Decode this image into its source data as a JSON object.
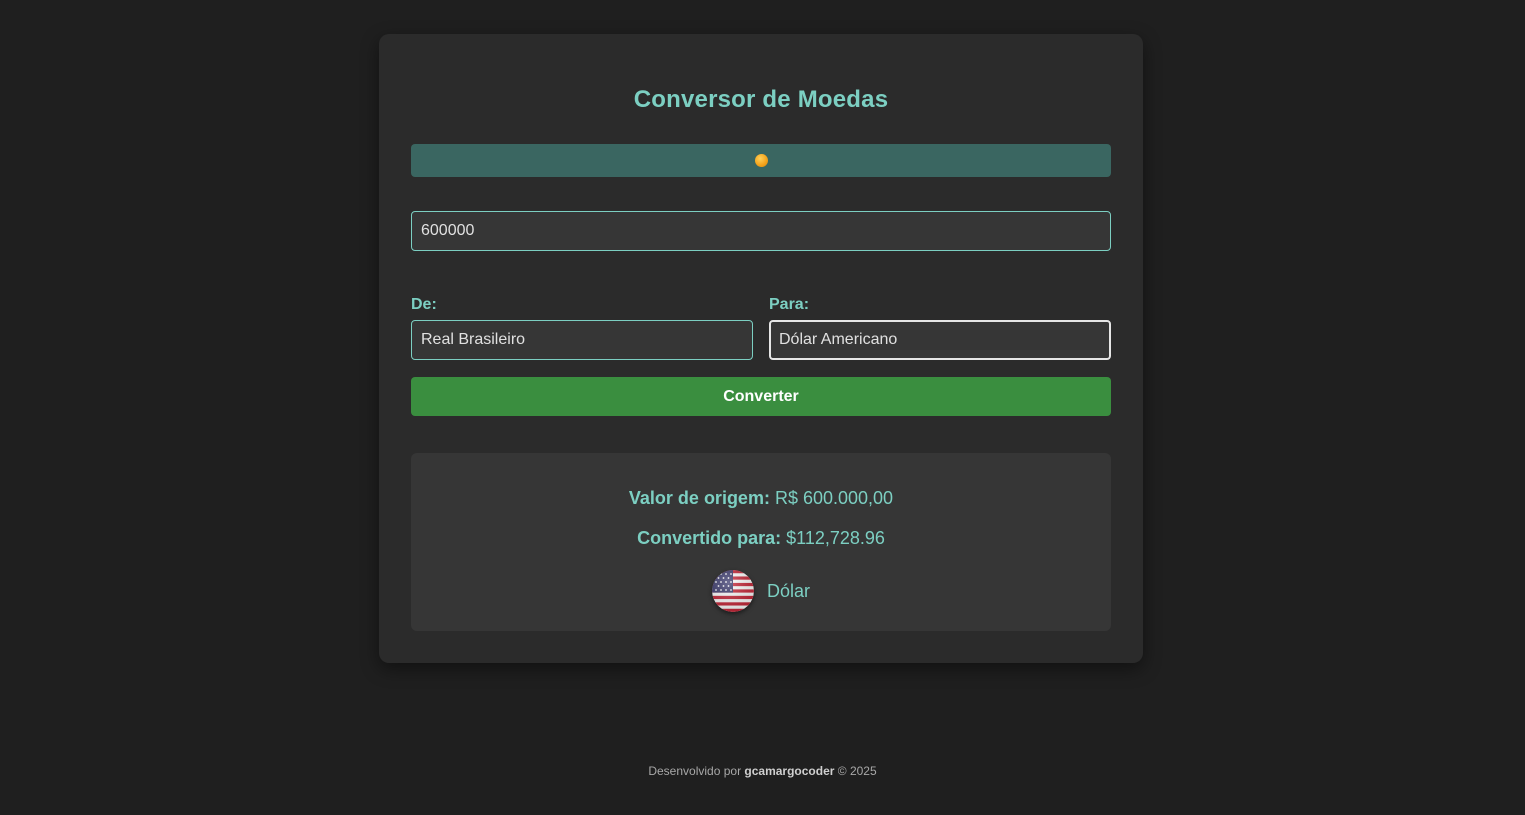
{
  "app": {
    "title": "Conversor de Moedas"
  },
  "banner": {
    "icon": "coin-icon",
    "icon_color": "#f5a51d",
    "background": "#3a6661"
  },
  "amount": {
    "value": "600000"
  },
  "from": {
    "label": "De:",
    "selected": "Real Brasileiro"
  },
  "to": {
    "label": "Para:",
    "selected": "Dólar Americano"
  },
  "convert_button": {
    "label": "Converter",
    "color": "#3a8e3f"
  },
  "result": {
    "origin_label": "Valor de origem:",
    "origin_value": "R$ 600.000,00",
    "converted_label": "Convertido para:",
    "converted_value": "$112,728.96",
    "currency_icon": "us-flag-icon",
    "currency_name": "Dólar"
  },
  "footer": {
    "prefix": "Desenvolvido por",
    "author": "gcamargocoder",
    "suffix": "© 2025"
  },
  "theme": {
    "accent": "#7ccfc2",
    "background": "#1f1f1f",
    "card": "#2b2b2b"
  }
}
